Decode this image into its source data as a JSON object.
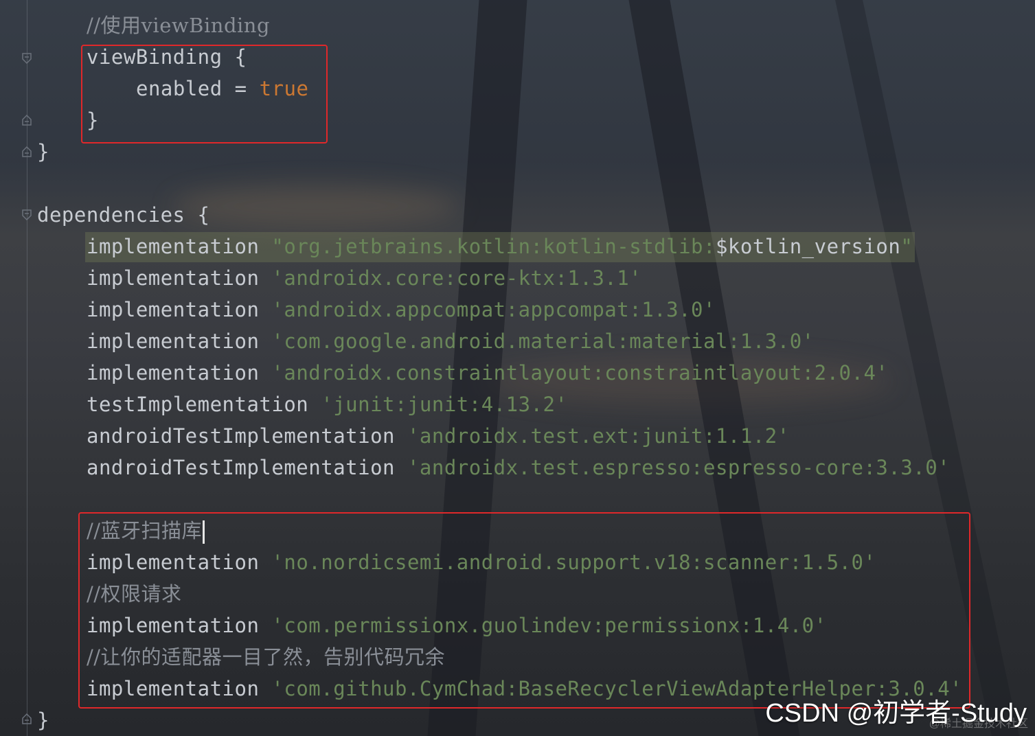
{
  "editor": {
    "lines": [
      {
        "indent": "    ",
        "parts": [
          {
            "t": "//使用viewBinding",
            "c": "cmt"
          }
        ]
      },
      {
        "indent": "    ",
        "parts": [
          {
            "t": "viewBinding {",
            "c": "plain"
          }
        ]
      },
      {
        "indent": "        ",
        "parts": [
          {
            "t": "enabled = ",
            "c": "plain"
          },
          {
            "t": "true",
            "c": "bool"
          }
        ]
      },
      {
        "indent": "    ",
        "parts": [
          {
            "t": "}",
            "c": "plain"
          }
        ]
      },
      {
        "indent": "",
        "parts": [
          {
            "t": "}",
            "c": "plain"
          }
        ]
      },
      {
        "indent": "",
        "parts": []
      },
      {
        "indent": "",
        "parts": [
          {
            "t": "dependencies {",
            "c": "plain"
          }
        ]
      },
      {
        "indent": "    ",
        "parts": [
          {
            "t": "implementation ",
            "c": "plain"
          },
          {
            "t": "\"org.jetbrains.kotlin:kotlin-stdlib:",
            "c": "str"
          },
          {
            "t": "$kotlin_version",
            "c": "plain"
          },
          {
            "t": "\"",
            "c": "str"
          }
        ]
      },
      {
        "indent": "    ",
        "parts": [
          {
            "t": "implementation ",
            "c": "plain"
          },
          {
            "t": "'androidx.core:core-ktx:1.3.1'",
            "c": "str"
          }
        ]
      },
      {
        "indent": "    ",
        "parts": [
          {
            "t": "implementation ",
            "c": "plain"
          },
          {
            "t": "'androidx.appcompat:appcompat:1.3.0'",
            "c": "str"
          }
        ]
      },
      {
        "indent": "    ",
        "parts": [
          {
            "t": "implementation ",
            "c": "plain"
          },
          {
            "t": "'com.google.android.material:material:1.3.0'",
            "c": "str"
          }
        ]
      },
      {
        "indent": "    ",
        "parts": [
          {
            "t": "implementation ",
            "c": "plain"
          },
          {
            "t": "'androidx.constraintlayout:constraintlayout:2.0.4'",
            "c": "str"
          }
        ]
      },
      {
        "indent": "    ",
        "parts": [
          {
            "t": "testImplementation ",
            "c": "plain"
          },
          {
            "t": "'junit:junit:4.13.2'",
            "c": "str"
          }
        ]
      },
      {
        "indent": "    ",
        "parts": [
          {
            "t": "androidTestImplementation ",
            "c": "plain"
          },
          {
            "t": "'androidx.test.ext:junit:1.1.2'",
            "c": "str"
          }
        ]
      },
      {
        "indent": "    ",
        "parts": [
          {
            "t": "androidTestImplementation ",
            "c": "plain"
          },
          {
            "t": "'androidx.test.espresso:espresso-core:3.3.0'",
            "c": "str"
          }
        ]
      },
      {
        "indent": "",
        "parts": []
      },
      {
        "indent": "    ",
        "parts": [
          {
            "t": "//蓝牙扫描库",
            "c": "cmt"
          }
        ],
        "caret": true
      },
      {
        "indent": "    ",
        "parts": [
          {
            "t": "implementation ",
            "c": "plain"
          },
          {
            "t": "'no.nordicsemi.android.support.v18:scanner:1.5.0'",
            "c": "str"
          }
        ]
      },
      {
        "indent": "    ",
        "parts": [
          {
            "t": "//权限请求",
            "c": "cmt"
          }
        ]
      },
      {
        "indent": "    ",
        "parts": [
          {
            "t": "implementation ",
            "c": "plain"
          },
          {
            "t": "'com.permissionx.guolindev:permissionx:1.4.0'",
            "c": "str"
          }
        ]
      },
      {
        "indent": "    ",
        "parts": [
          {
            "t": "//让你的适配器一目了然，告别代码冗余",
            "c": "cmt"
          }
        ]
      },
      {
        "indent": "    ",
        "parts": [
          {
            "t": "implementation ",
            "c": "plain"
          },
          {
            "t": "'com.github.CymChad:BaseRecyclerViewAdapterHelper:3.0.4'",
            "c": "str"
          }
        ]
      },
      {
        "indent": "",
        "parts": [
          {
            "t": "}",
            "c": "plain"
          }
        ]
      }
    ]
  },
  "watermark": {
    "text": "CSDN @初学者-Study",
    "faint": "@稀土掘金技术社区"
  },
  "colors": {
    "string": "#6a8759",
    "keyword_bool": "#cc7832",
    "comment": "#8a8f97",
    "plain": "#c8ccd2",
    "annotation_box": "#e0282a"
  },
  "icons": [
    "fold-collapse-icon",
    "fold-end-icon"
  ]
}
